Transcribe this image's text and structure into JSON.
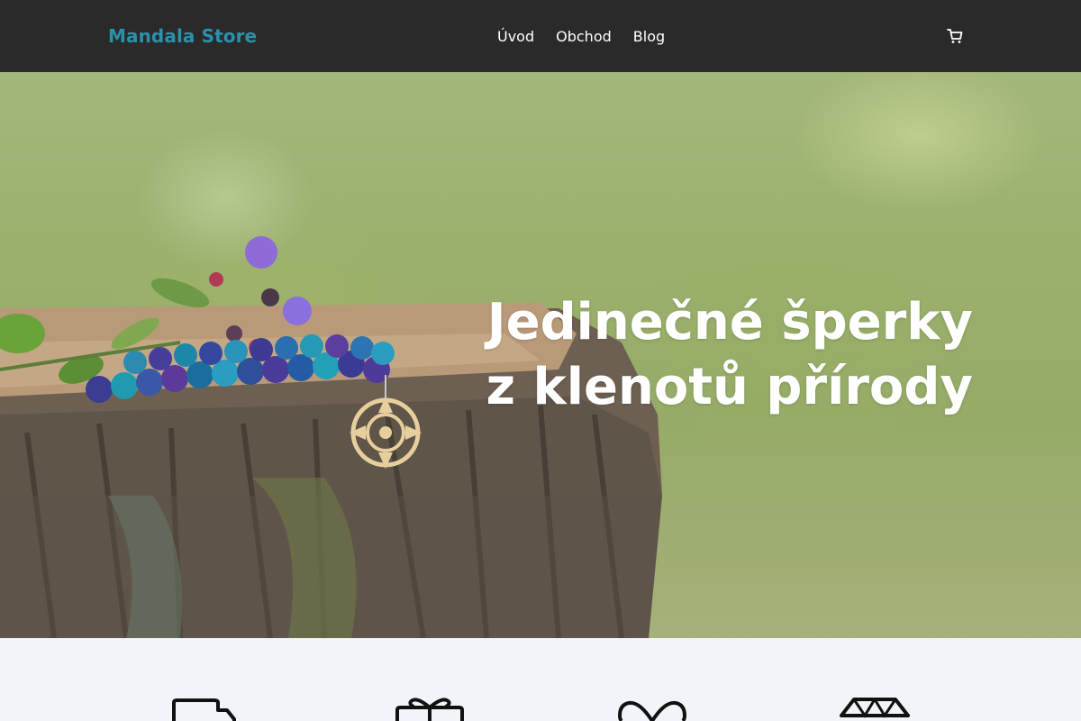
{
  "header": {
    "brand": "Mandala Store",
    "nav": [
      "Úvod",
      "Obchod",
      "Blog"
    ],
    "cart_icon": "cart-icon"
  },
  "hero": {
    "title_line1": "Jedinečné šperky",
    "title_line2": "z klenotů přírody"
  },
  "features": {
    "icons": [
      "truck-icon",
      "gift-icon",
      "heart-icon",
      "diamond-icon"
    ]
  },
  "colors": {
    "header_bg": "#2a2a2a",
    "brand": "#2b91ab",
    "nav_text": "#ffffff",
    "features_bg": "#f1f4f8"
  }
}
